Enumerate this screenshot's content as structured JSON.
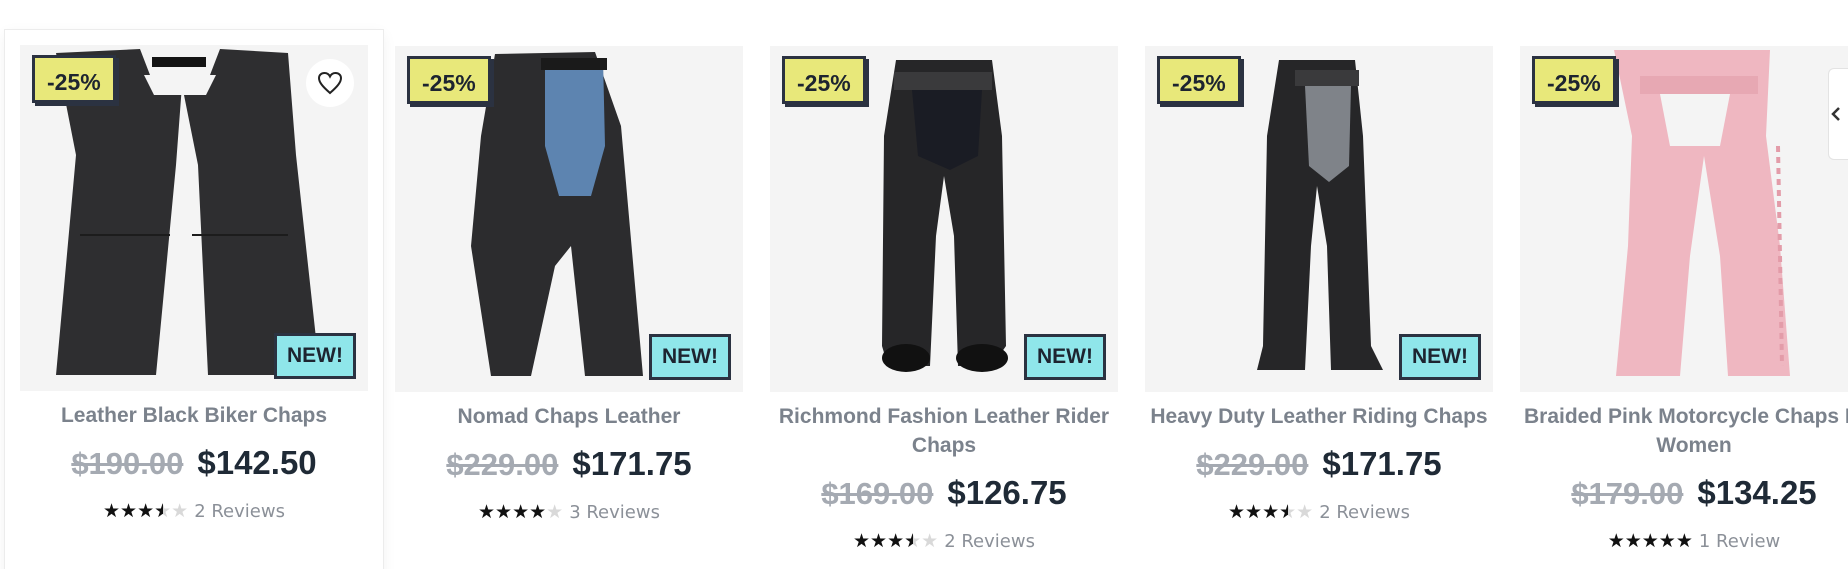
{
  "colors": {
    "discount_badge": "#e8e87a",
    "new_badge": "#8fe6ea",
    "badge_border": "#2b3241",
    "title": "#7b828c",
    "old_price": "#a5aab2",
    "new_price": "#1f2a36"
  },
  "products": [
    {
      "discount": "-25%",
      "new_label": "NEW!",
      "title_line1": "Leather Black Biker Chaps",
      "title_line2": "",
      "old_price": "$190.00",
      "price": "$142.50",
      "rating": 3.5,
      "reviews": "2 Reviews",
      "icon": "wishlist-heart-icon"
    },
    {
      "discount": "-25%",
      "new_label": "NEW!",
      "title_line1": "Nomad Chaps Leather",
      "title_line2": "",
      "old_price": "$229.00",
      "price": "$171.75",
      "rating": 4,
      "reviews": "3 Reviews"
    },
    {
      "discount": "-25%",
      "new_label": "NEW!",
      "title_line1": "Richmond Fashion Leather Rider",
      "title_line2": "Chaps",
      "old_price": "$169.00",
      "price": "$126.75",
      "rating": 3.5,
      "reviews": "2 Reviews"
    },
    {
      "discount": "-25%",
      "new_label": "NEW!",
      "title_line1": "Heavy Duty Leather Riding Chaps",
      "title_line2": "",
      "old_price": "$229.00",
      "price": "$171.75",
      "rating": 3.5,
      "reviews": "2 Reviews"
    },
    {
      "discount": "-25%",
      "new_label": "",
      "title_line1": "Braided Pink Motorcycle Chaps For",
      "title_line2": "Women",
      "old_price": "$179.00",
      "price": "$134.25",
      "rating": 5,
      "reviews": "1 Review"
    }
  ],
  "carousel": {
    "prev_icon": "chevron-left-icon"
  }
}
